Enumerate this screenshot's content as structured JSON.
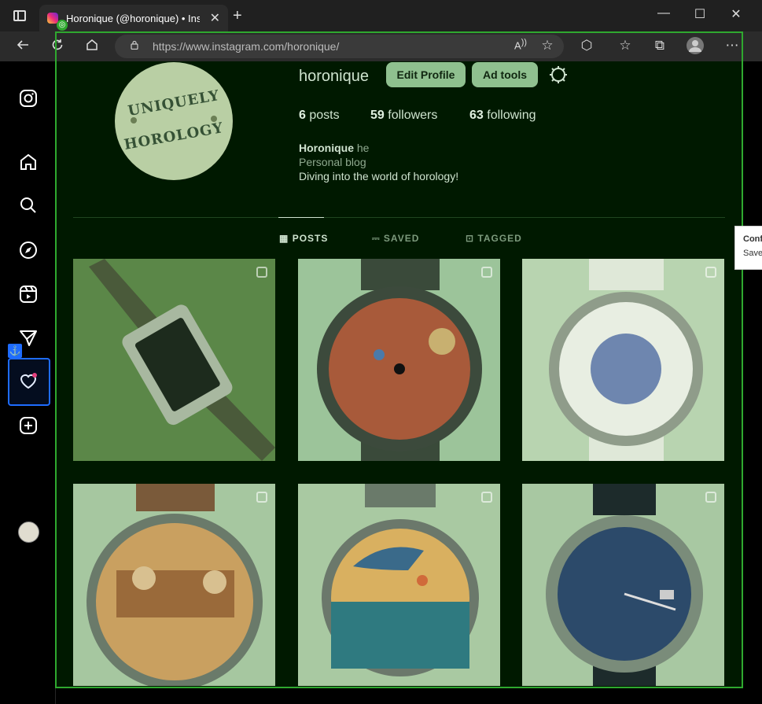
{
  "browser": {
    "tab_title": "Horonique (@horonique) • Instagram",
    "tab_close": "✕",
    "new_tab": "+",
    "win_min": "—",
    "win_max": "☐",
    "win_close": "✕",
    "url_host": "https://www.instagram.com",
    "url_path": "/horonique/"
  },
  "profile": {
    "username": "horonique",
    "edit_profile_label": "Edit Profile",
    "ad_tools_label": "Ad tools",
    "posts_count": "6",
    "posts_label": "posts",
    "followers_count": "59",
    "followers_label": "followers",
    "following_count": "63",
    "following_label": "following",
    "display_name": "Horonique",
    "pronouns": "he",
    "category": "Personal blog",
    "bio": "Diving into the world of horology!",
    "avatar_line1": "UNIQUELY",
    "avatar_line2": "HOROLOGY"
  },
  "tabs": [
    {
      "label": "POSTS"
    },
    {
      "label": "SAVED"
    },
    {
      "label": "TAGGED"
    }
  ],
  "tooltip": {
    "line1": "Conf",
    "line2": "Save"
  },
  "posts": [
    {
      "subject": "Tissot rectangular watch on dark leather strap"
    },
    {
      "subject": "Watch with red map dial"
    },
    {
      "subject": "Watch with blue-and-white illustrated dial"
    },
    {
      "subject": "Watch with illustrated circus scene dial"
    },
    {
      "subject": "Watch with whale and sea dial"
    },
    {
      "subject": "Omega Seamaster chronometer blue dial"
    }
  ],
  "overlay_badge": "◎",
  "anchor_badge": "⚓"
}
